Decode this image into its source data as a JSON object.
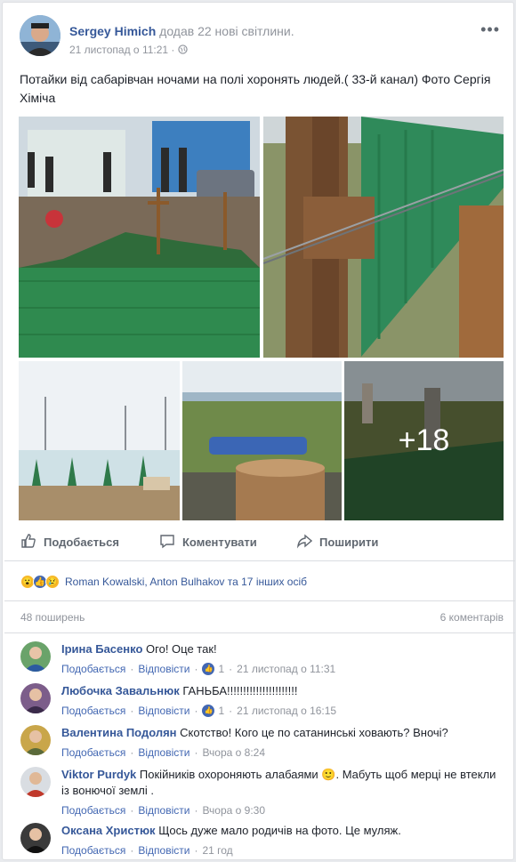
{
  "post": {
    "author": "Sergey Himich",
    "action": "додав 22 нові світлини.",
    "date": "21 листопад о 11:21",
    "privacy_icon": "globe-icon",
    "text": "Потайки від сабарівчан ночами на полі хоронять людей.( 33-й канал) Фото Сергія Хіміча",
    "more_photos": "+18"
  },
  "actions": {
    "like": "Подобається",
    "comment": "Коментувати",
    "share": "Поширити"
  },
  "reactions": {
    "names": "Roman Kowalski, Anton Bulhakov та 17 інших осіб"
  },
  "stats": {
    "shares": "48 поширень",
    "comments": "6 коментарів"
  },
  "comment_labels": {
    "like": "Подобається",
    "reply": "Відповісти"
  },
  "comments": [
    {
      "name": "Ірина Басенко",
      "text": "Ого! Оце так!",
      "likes": "1",
      "time": "21 листопад о 11:31"
    },
    {
      "name": "Любочка Завальнюк",
      "text": "ГАНЬБА!!!!!!!!!!!!!!!!!!!!!!",
      "likes": "1",
      "time": "21 листопад о 16:15"
    },
    {
      "name": "Валентина Подолян",
      "text": "Скотство! Кого це по сатанинські ховають? Вночі?",
      "time": "Вчора о 8:24"
    },
    {
      "name": "Viktor Purdyk",
      "text": "Покійників охороняють алабаями 🙂. Мабуть щоб мерці не втекли із вонючої землі .",
      "time": "Вчора о 9:30"
    },
    {
      "name": "Оксана Христюк",
      "text": "Щось дуже мало родичів на фото. Це муляж.",
      "time": "21 год"
    }
  ],
  "colors": {
    "link": "#365899",
    "accent": "#4267b2",
    "muted": "#90949c"
  }
}
